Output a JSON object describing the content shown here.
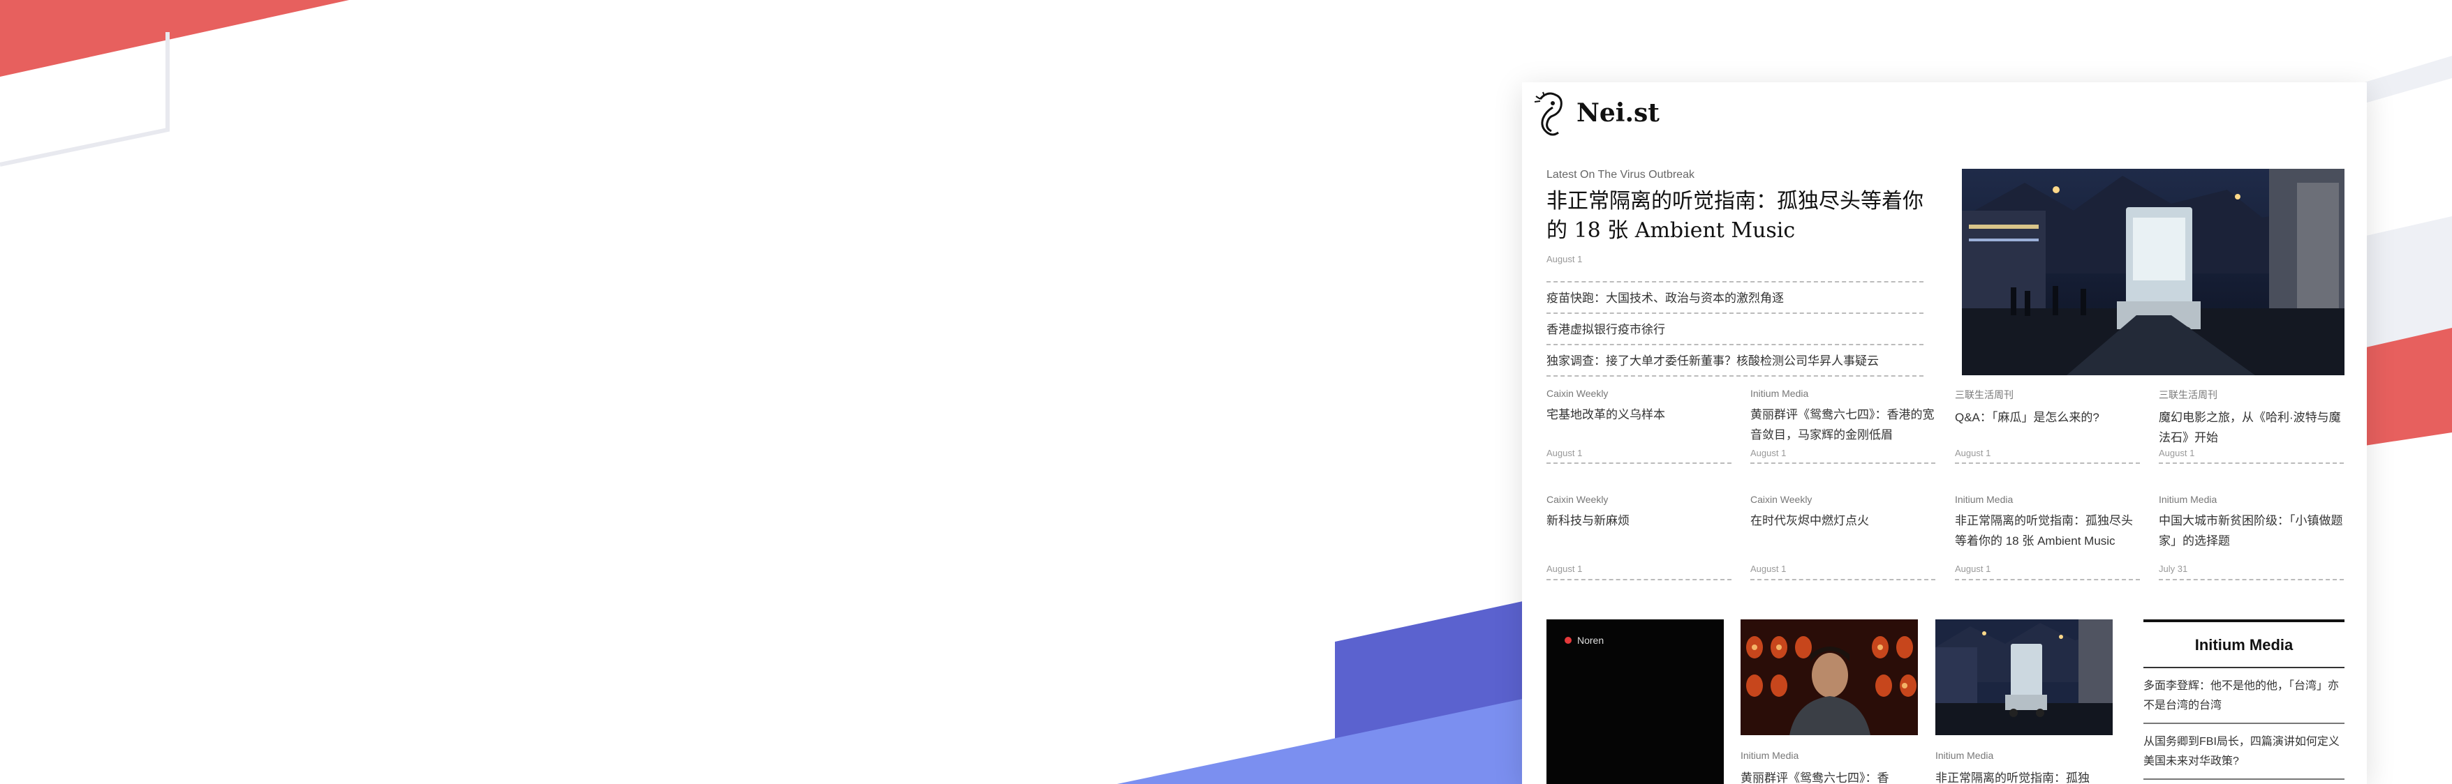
{
  "logo": {
    "name": "Nei.st"
  },
  "feature": {
    "kicker": "Latest On The Virus Outbreak",
    "headline": "非正常隔离的听觉指南：孤独尽头等着你的 18 张 Ambient Music",
    "date": "August 1",
    "links": [
      "疫苗快跑：大国技术、政治与资本的激烈角逐",
      "香港虚拟银行疫市徐行",
      "独家调查：接了大单才委任新董事？核酸检测公司华昇人事疑云"
    ]
  },
  "grid": [
    {
      "source": "Caixin Weekly",
      "title": "宅基地改革的义乌样本",
      "date": "August 1"
    },
    {
      "source": "Initium Media",
      "title": "黄丽群评《鸳鸯六七四》：香港的宽音敛目，马家辉的金刚低眉",
      "date": "August 1"
    },
    {
      "source": "三联生活周刊",
      "title": "Q&A：「麻瓜」是怎么来的?",
      "date": "August 1"
    },
    {
      "source": "三联生活周刊",
      "title": "魔幻电影之旅，从《哈利·波特与魔法石》开始",
      "date": "August 1"
    },
    {
      "source": "Caixin Weekly",
      "title": "新科技与新麻烦",
      "date": "August 1"
    },
    {
      "source": "Caixin Weekly",
      "title": "在时代灰烬中燃灯点火",
      "date": "August 1"
    },
    {
      "source": "Initium Media",
      "title": "非正常隔离的听觉指南：孤独尽头等着你的 18 张 Ambient Music",
      "date": "August 1"
    },
    {
      "source": "Initium Media",
      "title": "中国大城市新贫困阶级：「小镇做题家」的选择题",
      "date": "July 31"
    }
  ],
  "bottom": {
    "video_label": "Noren",
    "cards": [
      {
        "source": "Initium Media",
        "title": "黄丽群评《鸳鸯六七四》：香"
      },
      {
        "source": "Initium Media",
        "title": "非正常隔离的听觉指南：孤独"
      }
    ]
  },
  "sidebar": {
    "title": "Initium Media",
    "items": [
      "多面李登辉：他不是他的他，「台湾」亦不是台湾的台湾",
      "从国务卿到FBI局长，四篇演讲如何定义美国未来对华政策?"
    ]
  },
  "colors": {
    "coral": "#e7605e",
    "indigo": "#5b62cf",
    "periwinkle": "#7b8ff0",
    "ink": "#111111"
  }
}
